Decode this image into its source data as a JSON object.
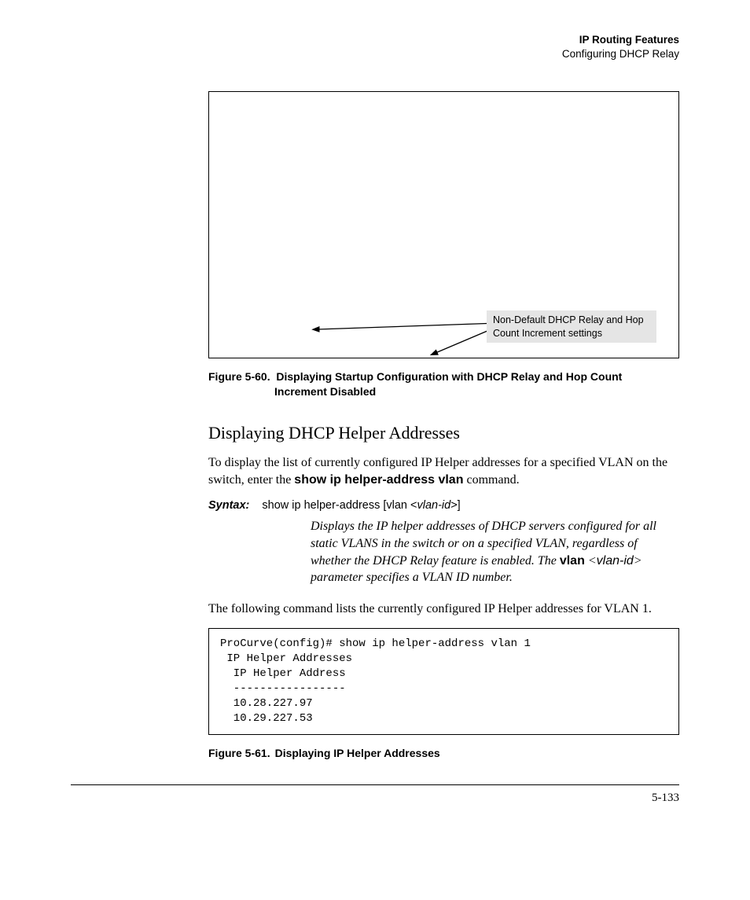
{
  "header": {
    "chapter": "IP Routing Features",
    "section": "Configuring DHCP Relay"
  },
  "figure60": {
    "annotation": "Non-Default DHCP Relay and Hop Count Increment settings",
    "caption_num": "Figure 5-60.",
    "caption_text_l1": "Displaying Startup Configuration with DHCP Relay and Hop Count",
    "caption_text_l2": "Increment Disabled"
  },
  "subhead": "Displaying DHCP Helper Addresses",
  "para1_a": "To display the list of currently configured IP Helper addresses for a specified VLAN on the switch, enter the ",
  "para1_bold": "show ip helper-address vlan",
  "para1_b": " command.",
  "syntax": {
    "label": "Syntax:",
    "text_a": "show ip helper-address [vlan <",
    "text_it": "vlan-id",
    "text_b": ">]"
  },
  "desc": {
    "t1": "Displays the IP helper addresses of DHCP servers configured for all static VLANS in the switch or on a specified VLAN, regardless of whether the DHCP Relay feature is enabled. The ",
    "bold": "vlan",
    "t2": " <",
    "it": "vlan-id",
    "t3": "> parameter specifies a VLAN ID number."
  },
  "para2": "The following command lists the currently configured IP Helper addresses for VLAN 1.",
  "code": "ProCurve(config)# show ip helper-address vlan 1\n IP Helper Addresses\n  IP Helper Address\n  -----------------\n  10.28.227.97\n  10.29.227.53",
  "figure61": {
    "caption_num": "Figure 5-61.",
    "caption_text": "Displaying IP Helper Addresses"
  },
  "pagenum": "5-133"
}
